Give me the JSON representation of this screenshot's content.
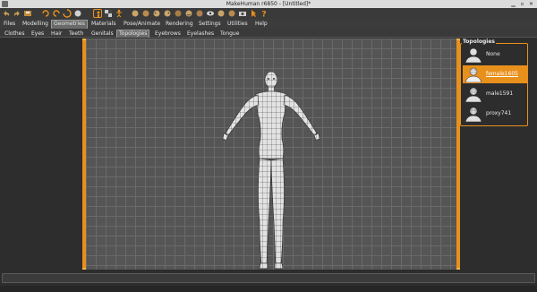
{
  "window": {
    "title": "MakeHuman r6850 - [Untitled]*"
  },
  "main_tabs": [
    {
      "label": "Files",
      "active": false
    },
    {
      "label": "Modelling",
      "active": false
    },
    {
      "label": "Geometries",
      "active": true
    },
    {
      "label": "Materials",
      "active": false
    },
    {
      "label": "Pose/Animate",
      "active": false
    },
    {
      "label": "Rendering",
      "active": false
    },
    {
      "label": "Settings",
      "active": false
    },
    {
      "label": "Utilities",
      "active": false
    },
    {
      "label": "Help",
      "active": false
    }
  ],
  "sub_tabs": [
    {
      "label": "Clothes",
      "active": false
    },
    {
      "label": "Eyes",
      "active": false
    },
    {
      "label": "Hair",
      "active": false
    },
    {
      "label": "Teeth",
      "active": false
    },
    {
      "label": "Genitals",
      "active": false
    },
    {
      "label": "Topologies",
      "active": true
    },
    {
      "label": "Eyebrows",
      "active": false
    },
    {
      "label": "Eyelashes",
      "active": false
    },
    {
      "label": "Tongue",
      "active": false
    }
  ],
  "toolbar_icons": [
    "undo-icon",
    "redo-icon",
    "reset-icon",
    "save-icon",
    "load-icon",
    "export-icon",
    "smooth-icon",
    "wireframe-icon",
    "background-icon",
    "pose-icon",
    "front-view-icon",
    "back-view-icon",
    "left-view-icon",
    "right-view-icon",
    "top-view-icon",
    "bottom-view-icon",
    "reset-camera-icon",
    "screenshot-icon",
    "help-icon"
  ],
  "topologies": {
    "title": "Topologies",
    "items": [
      {
        "label": "None",
        "selected": false
      },
      {
        "label": "female1605",
        "selected": true
      },
      {
        "label": "male1591",
        "selected": false
      },
      {
        "label": "proxy741",
        "selected": false
      }
    ]
  },
  "colors": {
    "accent": "#e8901c",
    "viewport_bg": "#555555",
    "grid": "#6a6a6a",
    "panel_bg": "#2d2d2d"
  }
}
